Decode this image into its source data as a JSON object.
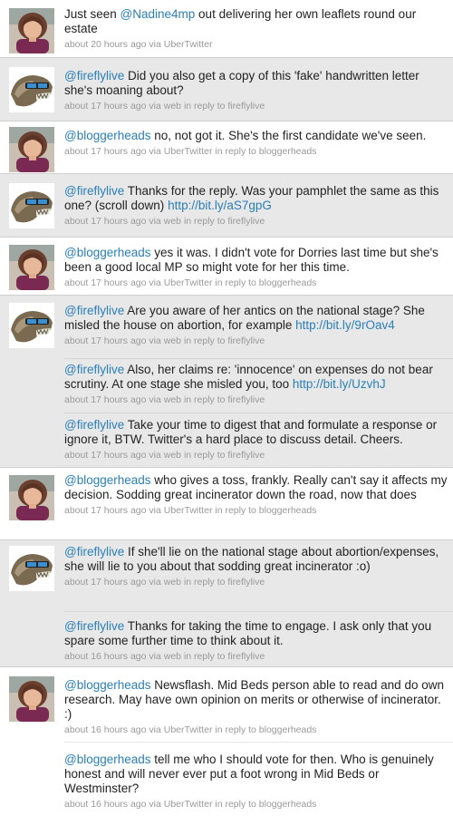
{
  "theme": {
    "mention_color": "#2a7fb6",
    "meta_color": "#999999",
    "gray_bg": "#e8e8e8"
  },
  "users": {
    "local": {
      "avatar": "woman-portrait-avatar"
    },
    "blogger": {
      "avatar": "skull-sunglasses-avatar"
    }
  },
  "tweets": [
    {
      "pre": "Just seen ",
      "mention": "@Nadine4mp",
      "post": " out delivering her own leaflets round our estate",
      "time": "about 20 hours ago",
      "via": " via UberTwitter",
      "reply": ""
    },
    {
      "pre": "",
      "mention": "@fireflylive",
      "post": " Did you also get a copy of this 'fake' handwritten letter she's moaning about?",
      "time": "about 17 hours ago",
      "via": " via web",
      "reply": " in reply to fireflylive"
    },
    {
      "pre": "",
      "mention": "@bloggerheads",
      "post": " no, not got it. She's the first candidate we've seen.",
      "time": "about 17 hours ago",
      "via": " via UberTwitter",
      "reply": " in reply to bloggerheads"
    },
    {
      "pre": "",
      "mention": "@fireflylive",
      "post": " Thanks for the reply. Was your pamphlet the same as this one? (scroll down) ",
      "link": "http://bit.ly/aS7gpG",
      "time": "about 17 hours ago",
      "via": " via web",
      "reply": " in reply to fireflylive"
    },
    {
      "pre": "",
      "mention": "@bloggerheads",
      "post": " yes it was. I didn't vote for Dorries last time but she's been a good local MP so might vote for her this time.",
      "time": "about 17 hours ago",
      "via": " via UberTwitter",
      "reply": " in reply to bloggerheads"
    },
    {
      "pre": "",
      "mention": "@fireflylive",
      "post": " Are you aware of her antics on the national stage? She misled the house on abortion, for example ",
      "link": "http://bit.ly/9rOav4",
      "time": "about 17 hours ago",
      "via": " via web",
      "reply": " in reply to fireflylive"
    },
    {
      "pre": "",
      "mention": "@fireflylive",
      "post": " Also, her claims re: 'innocence' on expenses do not bear scrutiny. At one stage she misled you, too ",
      "link": "http://bit.ly/UzvhJ",
      "time": "about 17 hours ago",
      "via": " via web",
      "reply": " in reply to fireflylive"
    },
    {
      "pre": "",
      "mention": "@fireflylive",
      "post": " Take your time to digest that and formulate a response or ignore it, BTW. Twitter's a hard place to discuss detail. Cheers.",
      "time": "about 17 hours ago",
      "via": " via web",
      "reply": " in reply to fireflylive"
    },
    {
      "pre": "",
      "mention": "@bloggerheads",
      "post": " who gives a toss, frankly. Really can't say it affects my decision. Sodding great incinerator down the road, now that does",
      "time": "about 17 hours ago",
      "via": " via UberTwitter",
      "reply": " in reply to bloggerheads"
    },
    {
      "pre": "",
      "mention": "@fireflylive",
      "post": " If she'll lie on the national stage about abortion/expenses, she will lie to you about that sodding great incinerator :o)",
      "time": "about 17 hours ago",
      "via": " via web",
      "reply": " in reply to fireflylive"
    },
    {
      "pre": "",
      "mention": "@fireflylive",
      "post": " Thanks for taking the time to engage. I ask only that you spare some further time to think about it.",
      "time": "about 16 hours ago",
      "via": " via web",
      "reply": " in reply to fireflylive"
    },
    {
      "pre": "",
      "mention": "@bloggerheads",
      "post": " Newsflash. Mid Beds person able to read and do own research. May have own opinion on merits or otherwise of incinerator. :)",
      "time": "about 16 hours ago",
      "via": " via UberTwitter",
      "reply": " in reply to bloggerheads"
    },
    {
      "pre": "",
      "mention": "@bloggerheads",
      "post": " tell me who I should vote for then. Who is genuinely honest and will never ever put a foot wrong in Mid Beds or Westminster?",
      "time": "about 16 hours ago",
      "via": " via UberTwitter",
      "reply": " in reply to bloggerheads"
    }
  ]
}
